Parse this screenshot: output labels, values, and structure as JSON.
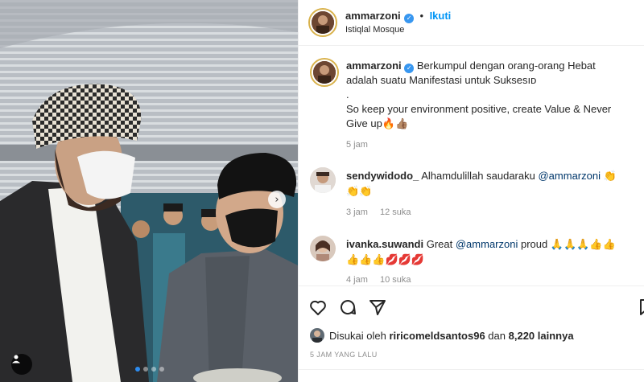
{
  "post": {
    "username": "ammarzoni",
    "follow_label": "Ikuti",
    "location": "Istiqlal Mosque",
    "caption_line1": "Berkumpul dengan orang-orang Hebat adalah suatu Manifestasi untuk Suksesıᴅ",
    "caption_line2": ".",
    "caption_line3": "So keep your environment positive, create Value & Never Give up",
    "caption_emoji": "🔥👍🏽",
    "caption_time": "5 jam"
  },
  "comments": [
    {
      "username": "sendywidodo_",
      "text": "Alhamdulillah saudaraku",
      "mention": "@ammarzoni",
      "emoji": "👏👏👏",
      "time": "3 jam",
      "likes": "12 suka"
    },
    {
      "username": "ivanka.suwandi",
      "text": "Great",
      "mention": "@ammarzoni",
      "after": "proud",
      "emoji": "🙏🙏🙏👍👍👍👍👍💋💋💋",
      "time": "4 jam",
      "likes": "10 suka"
    }
  ],
  "likes": {
    "prefix": "Disukai oleh",
    "user": "riricomeldsantos96",
    "middle": "dan",
    "count": "8,220 lainnya"
  },
  "time_ago": "5 JAM YANG LALU",
  "icons": [
    "heart-icon",
    "comment-icon",
    "share-icon",
    "bookmark-icon",
    "chevron-right-icon",
    "user-tag-icon",
    "verified-icon"
  ],
  "colors": {
    "accent": "#0095f6",
    "verified": "#3897f0",
    "active_dot": "#2d8cf0"
  }
}
